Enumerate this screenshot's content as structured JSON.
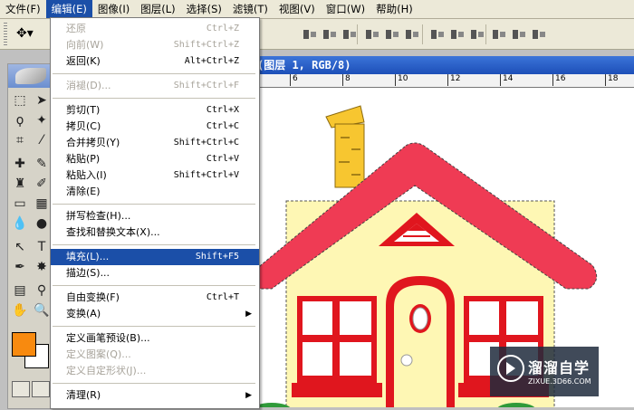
{
  "menubar": {
    "items": [
      "文件(F)",
      "编辑(E)",
      "图像(I)",
      "图层(L)",
      "选择(S)",
      "滤镜(T)",
      "视图(V)",
      "窗口(W)",
      "帮助(H)"
    ],
    "active_index": 1
  },
  "document": {
    "title": "(图层 1, RGB/8)",
    "ruler_ticks": [
      "6",
      "8",
      "10",
      "12",
      "14",
      "16",
      "18"
    ]
  },
  "colors": {
    "foreground": "#f88a0f",
    "background": "#ffffff",
    "menu_highlight": "#1b4fa8",
    "roof": "#ef3b54",
    "wall": "#fef7b4",
    "chimney": "#f7c630",
    "trim": "#e0161e"
  },
  "edit_menu": {
    "items": [
      {
        "label": "还原",
        "shortcut": "Ctrl+Z",
        "disabled": true
      },
      {
        "label": "向前(W)",
        "shortcut": "Shift+Ctrl+Z",
        "disabled": true
      },
      {
        "label": "返回(K)",
        "shortcut": "Alt+Ctrl+Z",
        "disabled": false
      },
      {
        "label": "消褪(D)...",
        "shortcut": "Shift+Ctrl+F",
        "disabled": true
      },
      {
        "label": "剪切(T)",
        "shortcut": "Ctrl+X",
        "disabled": false
      },
      {
        "label": "拷贝(C)",
        "shortcut": "Ctrl+C",
        "disabled": false
      },
      {
        "label": "合并拷贝(Y)",
        "shortcut": "Shift+Ctrl+C",
        "disabled": false
      },
      {
        "label": "粘贴(P)",
        "shortcut": "Ctrl+V",
        "disabled": false
      },
      {
        "label": "粘贴入(I)",
        "shortcut": "Shift+Ctrl+V",
        "disabled": false
      },
      {
        "label": "清除(E)",
        "shortcut": "",
        "disabled": false
      },
      {
        "label": "拼写检查(H)...",
        "shortcut": "",
        "disabled": false
      },
      {
        "label": "查找和替换文本(X)...",
        "shortcut": "",
        "disabled": false
      },
      {
        "label": "填充(L)...",
        "shortcut": "Shift+F5",
        "disabled": false
      },
      {
        "label": "描边(S)...",
        "shortcut": "",
        "disabled": false
      },
      {
        "label": "自由变换(F)",
        "shortcut": "Ctrl+T",
        "disabled": false
      },
      {
        "label": "变换(A)",
        "shortcut": "",
        "disabled": false
      },
      {
        "label": "定义画笔预设(B)...",
        "shortcut": "",
        "disabled": false
      },
      {
        "label": "定义图案(Q)...",
        "shortcut": "",
        "disabled": true
      },
      {
        "label": "定义自定形状(J)...",
        "shortcut": "",
        "disabled": true
      },
      {
        "label": "清理(R)",
        "shortcut": "",
        "disabled": false
      }
    ],
    "highlighted_index": 12
  },
  "watermark": {
    "name": "溜溜自学",
    "url": "ZIXUE.3D66.COM"
  }
}
